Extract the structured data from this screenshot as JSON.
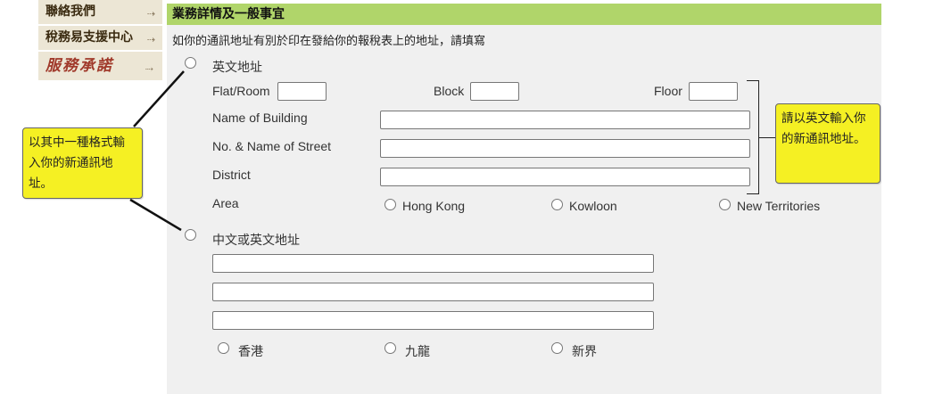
{
  "sidebar": {
    "items": [
      {
        "label": "聯絡我們"
      },
      {
        "label": "稅務易支援中心"
      },
      {
        "label": "服務承諾"
      }
    ]
  },
  "section": {
    "title": "業務詳情及一般事宜",
    "instruction": "如你的通訊地址有別於印在發給你的報稅表上的地址，請填寫"
  },
  "english_address": {
    "label": "英文地址",
    "flat_label": "Flat/Room",
    "flat_value": "",
    "block_label": "Block",
    "block_value": "",
    "floor_label": "Floor",
    "floor_value": "",
    "building_label": "Name of Building",
    "building_value": "",
    "street_label": "No. & Name of Street",
    "street_value": "",
    "district_label": "District",
    "district_value": "",
    "area_label": "Area",
    "area_options": [
      "Hong Kong",
      "Kowloon",
      "New Territories"
    ]
  },
  "chinese_address": {
    "label": "中文或英文地址",
    "line1_value": "",
    "line2_value": "",
    "line3_value": "",
    "area_options": [
      "香港",
      "九龍",
      "新界"
    ]
  },
  "callouts": {
    "left": "以其中一種格式輸入你的新通訊地址。",
    "right": "請以英文輸入你的新通訊地址。"
  },
  "colors": {
    "header_bg": "#b0d56a",
    "callout_bg": "#f5f023",
    "sidebar_bg": "#ece6d5"
  }
}
